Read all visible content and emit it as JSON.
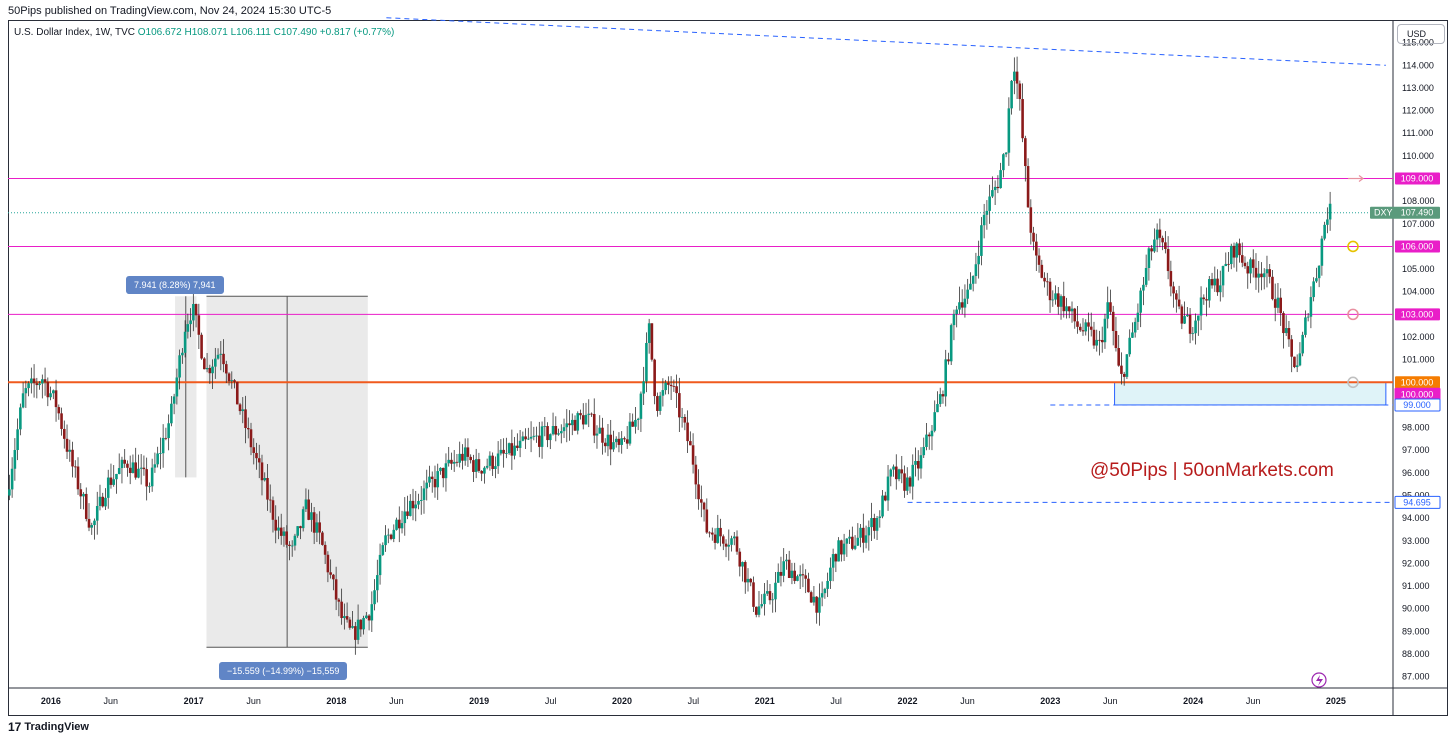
{
  "header": {
    "published_line": "50Pips published on TradingView.com, Nov 24, 2024 15:30 UTC-5"
  },
  "legend": {
    "symbol_line": "U.S. Dollar Index, 1W, TVC",
    "open": "O106.672",
    "high": "H108.071",
    "low": "L106.111",
    "close": "C107.490",
    "change": "+0.817 (+0.77%)"
  },
  "currency_button": "USD",
  "footer": {
    "brand": "TradingView",
    "logo_glyph": "17"
  },
  "watermark": "@50Pips | 50onMarkets.com",
  "measures": {
    "top_label": "7.941 (8.28%) 7,941",
    "bottom_label": "−15.559 (−14.99%) −15,559"
  },
  "colors": {
    "up": "#26a69a",
    "down": "#ef5350",
    "candle_body_up": "#089981",
    "candle_body_down": "#8b1a1a",
    "magenta_level": "#e91ec8",
    "orange_level": "#f05a1e",
    "blue_dashed": "#2962ff",
    "current_price_tag": "#5a9a7c",
    "measure_box": "#e6e6e6"
  },
  "chart_data": {
    "type": "candlestick",
    "title": "U.S. Dollar Index, 1W, TVC",
    "symbol": "DXY",
    "y_axis": {
      "ticks": [
        87.0,
        88.0,
        89.0,
        90.0,
        91.0,
        92.0,
        93.0,
        94.0,
        95.0,
        96.0,
        97.0,
        98.0,
        99.0,
        100.0,
        101.0,
        102.0,
        103.0,
        104.0,
        105.0,
        106.0,
        107.0,
        108.0,
        109.0,
        110.0,
        111.0,
        112.0,
        113.0,
        114.0,
        115.0
      ],
      "tick_labels": [
        "87.000",
        "88.000",
        "89.000",
        "90.000",
        "91.000",
        "92.000",
        "93.000",
        "94.000",
        "95.000",
        "96.000",
        "97.000",
        "98.000",
        "99.000",
        "100.000",
        "101.000",
        "102.000",
        "103.000",
        "104.000",
        "105.000",
        "106.000",
        "107.000",
        "108.000",
        "109.000",
        "110.000",
        "111.000",
        "112.000",
        "113.000",
        "114.000",
        "115.000"
      ],
      "range": [
        86.5,
        116.0
      ]
    },
    "x_axis": {
      "range": [
        2015.7,
        2025.4
      ],
      "ticks": [
        {
          "label": "2016",
          "t": 2016.0
        },
        {
          "label": "Jun",
          "t": 2016.42
        },
        {
          "label": "2017",
          "t": 2017.0
        },
        {
          "label": "Jun",
          "t": 2017.42
        },
        {
          "label": "2018",
          "t": 2018.0
        },
        {
          "label": "Jun",
          "t": 2018.42
        },
        {
          "label": "2019",
          "t": 2019.0
        },
        {
          "label": "Jul",
          "t": 2019.5
        },
        {
          "label": "2020",
          "t": 2020.0
        },
        {
          "label": "Jul",
          "t": 2020.5
        },
        {
          "label": "2021",
          "t": 2021.0
        },
        {
          "label": "Jul",
          "t": 2021.5
        },
        {
          "label": "2022",
          "t": 2022.0
        },
        {
          "label": "Jun",
          "t": 2022.42
        },
        {
          "label": "2023",
          "t": 2023.0
        },
        {
          "label": "Jun",
          "t": 2023.42
        },
        {
          "label": "2024",
          "t": 2024.0
        },
        {
          "label": "Jun",
          "t": 2024.42
        },
        {
          "label": "2025",
          "t": 2025.0
        }
      ]
    },
    "price_path": [
      [
        2015.7,
        95.0
      ],
      [
        2015.82,
        99.5
      ],
      [
        2015.95,
        100.2
      ],
      [
        2016.05,
        99.0
      ],
      [
        2016.15,
        96.5
      ],
      [
        2016.3,
        93.5
      ],
      [
        2016.4,
        95.5
      ],
      [
        2016.55,
        96.5
      ],
      [
        2016.7,
        95.5
      ],
      [
        2016.85,
        98.5
      ],
      [
        2016.95,
        102.5
      ],
      [
        2017.0,
        103.3
      ],
      [
        2017.1,
        100.5
      ],
      [
        2017.2,
        101.5
      ],
      [
        2017.3,
        99.5
      ],
      [
        2017.45,
        96.5
      ],
      [
        2017.6,
        93.5
      ],
      [
        2017.7,
        92.5
      ],
      [
        2017.8,
        94.5
      ],
      [
        2017.9,
        93.0
      ],
      [
        2018.05,
        89.5
      ],
      [
        2018.12,
        88.8
      ],
      [
        2018.25,
        90.0
      ],
      [
        2018.35,
        93.0
      ],
      [
        2018.5,
        94.5
      ],
      [
        2018.6,
        95.0
      ],
      [
        2018.75,
        96.0
      ],
      [
        2018.9,
        96.8
      ],
      [
        2019.0,
        96.2
      ],
      [
        2019.2,
        96.8
      ],
      [
        2019.4,
        97.5
      ],
      [
        2019.6,
        98.0
      ],
      [
        2019.75,
        98.5
      ],
      [
        2019.9,
        97.5
      ],
      [
        2020.0,
        97.0
      ],
      [
        2020.12,
        98.5
      ],
      [
        2020.2,
        102.3
      ],
      [
        2020.25,
        99.0
      ],
      [
        2020.35,
        100.0
      ],
      [
        2020.5,
        96.8
      ],
      [
        2020.6,
        93.5
      ],
      [
        2020.8,
        93.0
      ],
      [
        2020.95,
        90.0
      ],
      [
        2021.05,
        90.5
      ],
      [
        2021.15,
        92.0
      ],
      [
        2021.3,
        91.0
      ],
      [
        2021.4,
        90.0
      ],
      [
        2021.5,
        92.5
      ],
      [
        2021.65,
        93.0
      ],
      [
        2021.8,
        94.0
      ],
      [
        2021.9,
        96.0
      ],
      [
        2022.0,
        95.5
      ],
      [
        2022.1,
        96.5
      ],
      [
        2022.25,
        99.5
      ],
      [
        2022.35,
        103.5
      ],
      [
        2022.45,
        104.0
      ],
      [
        2022.55,
        107.5
      ],
      [
        2022.65,
        109.0
      ],
      [
        2022.7,
        110.5
      ],
      [
        2022.75,
        114.5
      ],
      [
        2022.8,
        112.0
      ],
      [
        2022.85,
        108.0
      ],
      [
        2022.9,
        105.5
      ],
      [
        2023.0,
        104.0
      ],
      [
        2023.1,
        103.5
      ],
      [
        2023.2,
        102.5
      ],
      [
        2023.3,
        102.0
      ],
      [
        2023.35,
        101.5
      ],
      [
        2023.42,
        103.5
      ],
      [
        2023.5,
        100.0
      ],
      [
        2023.6,
        102.5
      ],
      [
        2023.7,
        105.5
      ],
      [
        2023.75,
        106.5
      ],
      [
        2023.82,
        105.5
      ],
      [
        2023.9,
        103.0
      ],
      [
        2024.0,
        102.5
      ],
      [
        2024.1,
        104.0
      ],
      [
        2024.2,
        104.5
      ],
      [
        2024.3,
        106.0
      ],
      [
        2024.4,
        105.0
      ],
      [
        2024.5,
        105.0
      ],
      [
        2024.6,
        103.5
      ],
      [
        2024.7,
        101.0
      ],
      [
        2024.75,
        100.8
      ],
      [
        2024.82,
        103.5
      ],
      [
        2024.88,
        105.0
      ],
      [
        2024.93,
        107.0
      ],
      [
        2024.95,
        107.5
      ]
    ],
    "horizontal_levels": [
      {
        "price": 109.0,
        "label": "109.000",
        "color": "#e91ec8"
      },
      {
        "price": 106.0,
        "label": "106.000",
        "color": "#e91ec8"
      },
      {
        "price": 103.0,
        "label": "103.000",
        "color": "#e91ec8"
      },
      {
        "price": 100.0,
        "label": "100.000",
        "color": "#f05a1e"
      }
    ],
    "extra_tags": [
      {
        "price": 100.0,
        "label": "100.000",
        "color": "#e91ec8"
      },
      {
        "price": 99.0,
        "label": "99.000",
        "color": "#2962ff"
      },
      {
        "price": 94.695,
        "label": "94.695",
        "color": "#2962ff"
      }
    ],
    "current_price": {
      "symbol": "DXY",
      "value": 107.49,
      "label": "107.490"
    },
    "trendline": {
      "from": [
        2018.35,
        116.1
      ],
      "to": [
        2025.35,
        114.0
      ]
    },
    "dashed_levels": [
      {
        "price": 99.0,
        "from_t": 2023.0
      },
      {
        "price": 94.695,
        "from_t": 2022.0
      }
    ],
    "zone": {
      "t0": 2023.45,
      "t1": 2025.35,
      "p_top": 100.0,
      "p_bottom": 99.0
    },
    "measure_top": {
      "t0": 2016.87,
      "t1": 2017.02,
      "p_low": 95.8,
      "p_high": 103.8
    },
    "measure_bottom": {
      "t0": 2017.09,
      "t1": 2018.22,
      "p_low": 88.3,
      "p_high": 103.8
    }
  }
}
